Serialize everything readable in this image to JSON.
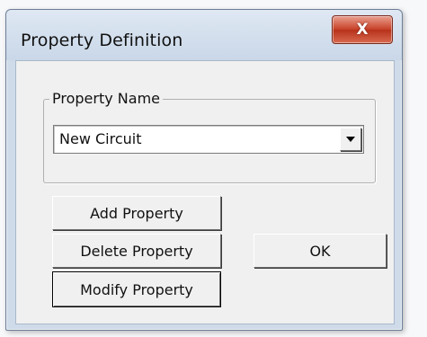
{
  "dialog": {
    "title": "Property Definition",
    "close_glyph": "X"
  },
  "property_name_group": {
    "legend": "Property Name",
    "selected_value": "New Circuit"
  },
  "buttons": {
    "add": "Add Property",
    "delete": "Delete Property",
    "modify": "Modify Property",
    "ok": "OK"
  },
  "icons": {
    "close": "close-icon",
    "dropdown": "chevron-down-icon"
  },
  "colors": {
    "dialog_face": "#f0f0f0",
    "titlebar": "#cfdbe9",
    "close_button": "#c8432a"
  }
}
